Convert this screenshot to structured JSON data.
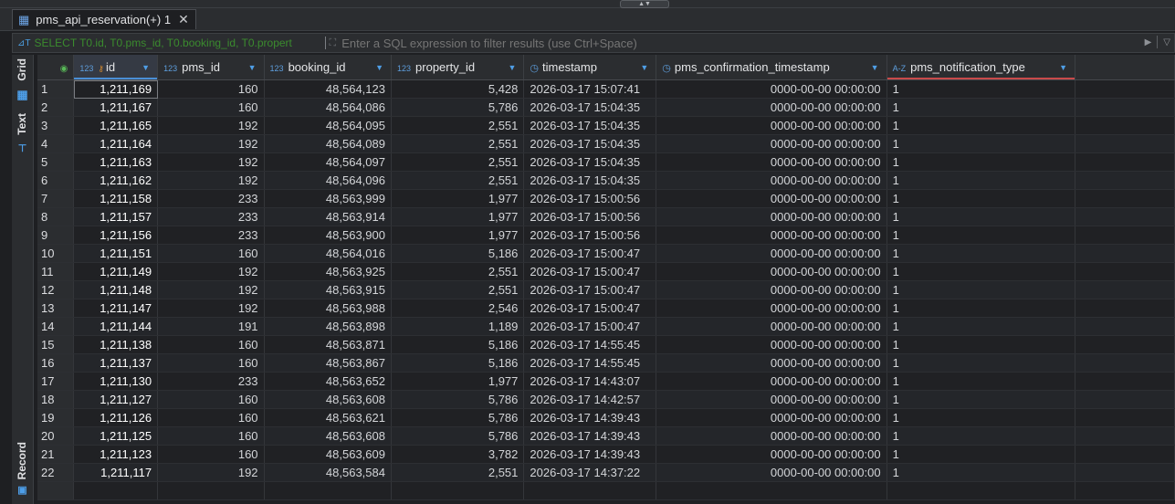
{
  "tab": {
    "label": "pms_api_reservation(+) 1",
    "close_icon": "close-icon"
  },
  "filter": {
    "sql_text": "SELECT T0.id, T0.pms_id, T0.booking_id, T0.propert",
    "placeholder": "Enter a SQL expression to filter results (use Ctrl+Space)"
  },
  "sidebar": {
    "grid_label": "Grid",
    "text_label": "Text",
    "record_label": "Record"
  },
  "columns": [
    {
      "name": "id",
      "type_badge": "123"
    },
    {
      "name": "pms_id",
      "type_badge": "123"
    },
    {
      "name": "booking_id",
      "type_badge": "123"
    },
    {
      "name": "property_id",
      "type_badge": "123"
    },
    {
      "name": "timestamp",
      "type_badge": "clock"
    },
    {
      "name": "pms_confirmation_timestamp",
      "type_badge": "clock"
    },
    {
      "name": "pms_notification_type",
      "type_badge": "A-Z"
    }
  ],
  "rows": [
    [
      "1",
      "1,211,169",
      "160",
      "48,564,123",
      "5,428",
      "2026-03-17 15:07:41",
      "0000-00-00 00:00:00",
      "1"
    ],
    [
      "2",
      "1,211,167",
      "160",
      "48,564,086",
      "5,786",
      "2026-03-17 15:04:35",
      "0000-00-00 00:00:00",
      "1"
    ],
    [
      "3",
      "1,211,165",
      "192",
      "48,564,095",
      "2,551",
      "2026-03-17 15:04:35",
      "0000-00-00 00:00:00",
      "1"
    ],
    [
      "4",
      "1,211,164",
      "192",
      "48,564,089",
      "2,551",
      "2026-03-17 15:04:35",
      "0000-00-00 00:00:00",
      "1"
    ],
    [
      "5",
      "1,211,163",
      "192",
      "48,564,097",
      "2,551",
      "2026-03-17 15:04:35",
      "0000-00-00 00:00:00",
      "1"
    ],
    [
      "6",
      "1,211,162",
      "192",
      "48,564,096",
      "2,551",
      "2026-03-17 15:04:35",
      "0000-00-00 00:00:00",
      "1"
    ],
    [
      "7",
      "1,211,158",
      "233",
      "48,563,999",
      "1,977",
      "2026-03-17 15:00:56",
      "0000-00-00 00:00:00",
      "1"
    ],
    [
      "8",
      "1,211,157",
      "233",
      "48,563,914",
      "1,977",
      "2026-03-17 15:00:56",
      "0000-00-00 00:00:00",
      "1"
    ],
    [
      "9",
      "1,211,156",
      "233",
      "48,563,900",
      "1,977",
      "2026-03-17 15:00:56",
      "0000-00-00 00:00:00",
      "1"
    ],
    [
      "10",
      "1,211,151",
      "160",
      "48,564,016",
      "5,186",
      "2026-03-17 15:00:47",
      "0000-00-00 00:00:00",
      "1"
    ],
    [
      "11",
      "1,211,149",
      "192",
      "48,563,925",
      "2,551",
      "2026-03-17 15:00:47",
      "0000-00-00 00:00:00",
      "1"
    ],
    [
      "12",
      "1,211,148",
      "192",
      "48,563,915",
      "2,551",
      "2026-03-17 15:00:47",
      "0000-00-00 00:00:00",
      "1"
    ],
    [
      "13",
      "1,211,147",
      "192",
      "48,563,988",
      "2,546",
      "2026-03-17 15:00:47",
      "0000-00-00 00:00:00",
      "1"
    ],
    [
      "14",
      "1,211,144",
      "191",
      "48,563,898",
      "1,189",
      "2026-03-17 15:00:47",
      "0000-00-00 00:00:00",
      "1"
    ],
    [
      "15",
      "1,211,138",
      "160",
      "48,563,871",
      "5,186",
      "2026-03-17 14:55:45",
      "0000-00-00 00:00:00",
      "1"
    ],
    [
      "16",
      "1,211,137",
      "160",
      "48,563,867",
      "5,186",
      "2026-03-17 14:55:45",
      "0000-00-00 00:00:00",
      "1"
    ],
    [
      "17",
      "1,211,130",
      "233",
      "48,563,652",
      "1,977",
      "2026-03-17 14:43:07",
      "0000-00-00 00:00:00",
      "1"
    ],
    [
      "18",
      "1,211,127",
      "160",
      "48,563,608",
      "5,786",
      "2026-03-17 14:42:57",
      "0000-00-00 00:00:00",
      "1"
    ],
    [
      "19",
      "1,211,126",
      "160",
      "48,563,621",
      "5,786",
      "2026-03-17 14:39:43",
      "0000-00-00 00:00:00",
      "1"
    ],
    [
      "20",
      "1,211,125",
      "160",
      "48,563,608",
      "5,786",
      "2026-03-17 14:39:43",
      "0000-00-00 00:00:00",
      "1"
    ],
    [
      "21",
      "1,211,123",
      "160",
      "48,563,609",
      "3,782",
      "2026-03-17 14:39:43",
      "0000-00-00 00:00:00",
      "1"
    ],
    [
      "22",
      "1,211,117",
      "192",
      "48,563,584",
      "2,551",
      "2026-03-17 14:37:22",
      "0000-00-00 00:00:00",
      "1"
    ]
  ],
  "colors": {
    "accent": "#4a8fd6",
    "sql_green": "#3b8b2e"
  }
}
